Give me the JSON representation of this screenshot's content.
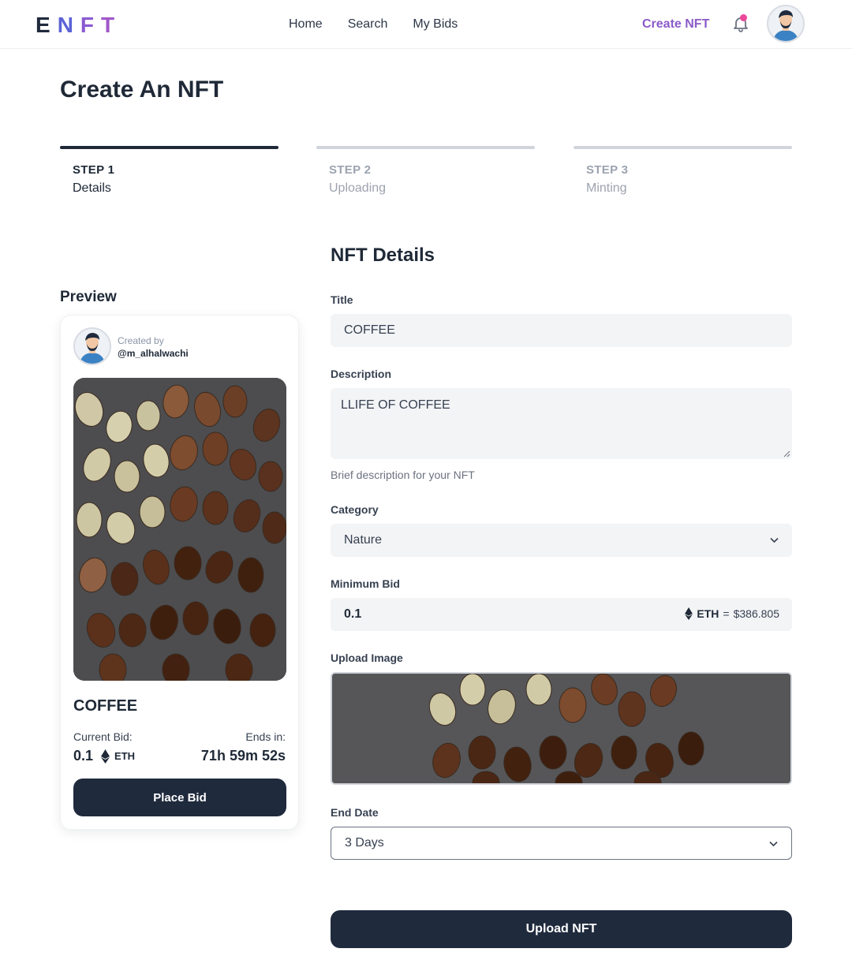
{
  "header": {
    "logo_letters": [
      "E",
      "N",
      "F",
      "T"
    ],
    "nav": [
      {
        "label": "Home"
      },
      {
        "label": "Search"
      },
      {
        "label": "My Bids"
      }
    ],
    "create_label": "Create NFT",
    "notification_icon": "bell-icon",
    "has_notification": true
  },
  "page": {
    "title": "Create An NFT"
  },
  "steps": [
    {
      "number": "STEP 1",
      "name": "Details",
      "active": true
    },
    {
      "number": "STEP 2",
      "name": "Uploading",
      "active": false
    },
    {
      "number": "STEP 3",
      "name": "Minting",
      "active": false
    }
  ],
  "preview": {
    "label": "Preview",
    "created_by_label": "Created by",
    "username": "@m_alhalwachi",
    "title": "COFFEE",
    "current_bid_label": "Current Bid:",
    "ends_label": "Ends in:",
    "bid_value": "0.1",
    "bid_unit": "ETH",
    "countdown": "71h 59m 52s",
    "place_bid_label": "Place Bid",
    "image_subject": "coffee beans"
  },
  "form": {
    "section_title": "NFT Details",
    "title_label": "Title",
    "title_value": "COFFEE",
    "description_label": "Description",
    "description_value": "LLIFE OF COFFEE",
    "description_hint": "Brief description for your NFT",
    "category_label": "Category",
    "category_value": "Nature",
    "min_bid_label": "Minimum Bid",
    "min_bid_value": "0.1",
    "eth_symbol": "ETH",
    "eth_equals": "=",
    "usd_value": "$386.805",
    "upload_label": "Upload Image",
    "end_date_label": "End Date",
    "end_date_value": "3 Days",
    "upload_button_label": "Upload NFT"
  },
  "colors": {
    "primary_dark": "#1f2a3d",
    "accent_purple": "#8b5bc9",
    "notification_pink": "#ec4899",
    "input_bg": "#f3f4f6"
  }
}
